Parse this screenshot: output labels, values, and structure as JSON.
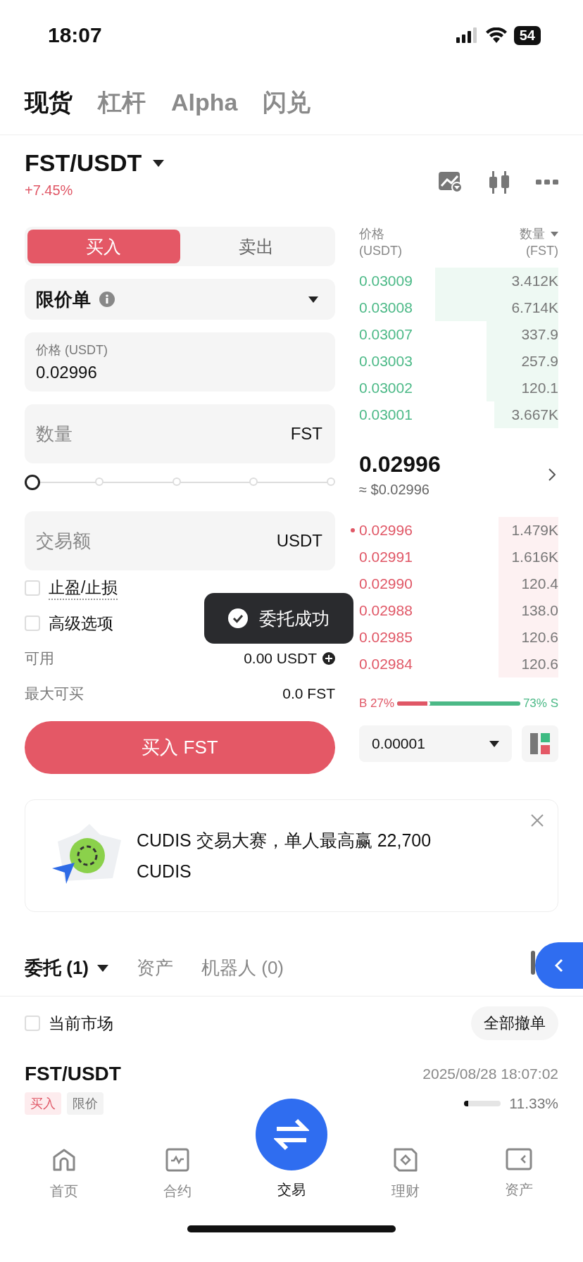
{
  "status_bar": {
    "time": "18:07",
    "battery": "54"
  },
  "top_tabs": [
    {
      "label": "现货",
      "selected": true
    },
    {
      "label": "杠杆",
      "selected": false
    },
    {
      "label": "Alpha",
      "selected": false
    },
    {
      "label": "闪兑",
      "selected": false
    }
  ],
  "pair": {
    "symbol": "FST/USDT",
    "change": "+7.45%"
  },
  "side_tabs": [
    {
      "label": "买入",
      "selected": true
    },
    {
      "label": "卖出",
      "selected": false
    }
  ],
  "order_type": {
    "label": "限价单"
  },
  "price_field": {
    "label": "价格 (USDT)",
    "value": "0.02996"
  },
  "quantity_field": {
    "placeholder": "数量",
    "unit": "FST"
  },
  "percent_slider": {
    "level": 0
  },
  "amount_field": {
    "placeholder": "交易额",
    "unit": "USDT"
  },
  "options": [
    {
      "label": "止盈/止损",
      "checked": false
    },
    {
      "label": "高级选项",
      "checked": false
    }
  ],
  "available": {
    "label": "可用",
    "value": "0.00 USDT"
  },
  "max_buy": {
    "label": "最大可买",
    "value": "0.0 FST"
  },
  "buy_button": "买入 FST",
  "orderbook": {
    "price_header": "价格",
    "price_unit": "(USDT)",
    "qty_header": "数量",
    "qty_unit": "(FST)",
    "asks": [
      {
        "price": "0.03009",
        "qty": "3.412K"
      },
      {
        "price": "0.03008",
        "qty": "6.714K"
      },
      {
        "price": "0.03007",
        "qty": "337.9"
      },
      {
        "price": "0.03003",
        "qty": "257.9"
      },
      {
        "price": "0.03002",
        "qty": "120.1"
      },
      {
        "price": "0.03001",
        "qty": "3.667K"
      }
    ],
    "last_price": "0.02996",
    "last_price_usd": "≈ $0.02996",
    "bids": [
      {
        "price": "0.02996",
        "qty": "1.479K",
        "own_order": true
      },
      {
        "price": "0.02991",
        "qty": "1.616K",
        "own_order": false
      },
      {
        "price": "0.02990",
        "qty": "120.4",
        "own_order": false
      },
      {
        "price": "0.02988",
        "qty": "138.0",
        "own_order": false
      },
      {
        "price": "0.02985",
        "qty": "120.6",
        "own_order": false
      },
      {
        "price": "0.02984",
        "qty": "120.6",
        "own_order": false
      }
    ],
    "buy_ratio": {
      "label": "B 27%",
      "level": 0.27
    },
    "sell_label": "73% S",
    "tick": "0.00001"
  },
  "toast": "委托成功",
  "banner": {
    "text": "CUDIS 交易大赛，单人最高赢 22,700 CUDIS"
  },
  "order_tabs": [
    {
      "label": "委托 (1)",
      "selected": true,
      "dropdown": true
    },
    {
      "label": "资产",
      "selected": false,
      "dropdown": false
    },
    {
      "label": "机器人 (0)",
      "selected": false,
      "dropdown": false
    }
  ],
  "filter": {
    "label": "当前市场",
    "checked": false
  },
  "cancel_all": "全部撤单",
  "orders": [
    {
      "pair": "FST/USDT",
      "time": "2025/08/28 18:07:02",
      "side": "买入",
      "type": "限价",
      "level": 0.1133,
      "filled": "11.33%"
    }
  ],
  "nav": [
    {
      "label": "首页",
      "kind": "home",
      "selected": false
    },
    {
      "label": "合约",
      "kind": "contract",
      "selected": false
    },
    {
      "label": "交易",
      "kind": "trade",
      "selected": true
    },
    {
      "label": "理财",
      "kind": "earn",
      "selected": false
    },
    {
      "label": "资产",
      "kind": "assets",
      "selected": false
    }
  ]
}
